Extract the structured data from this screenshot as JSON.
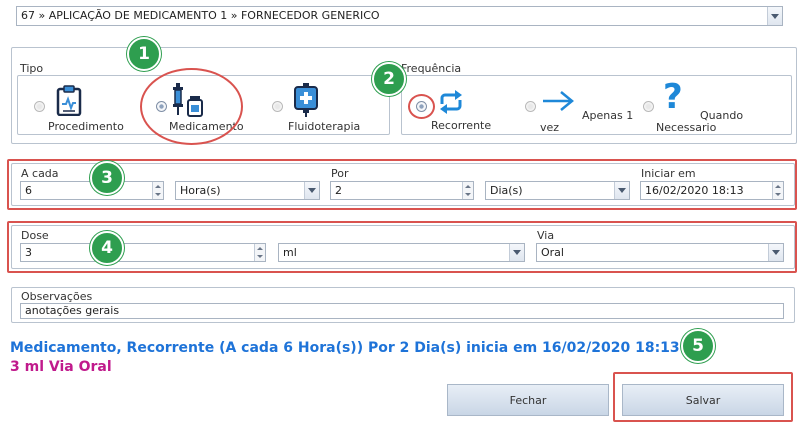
{
  "product_select": {
    "value": "67 » APLICAÇÃO DE MEDICAMENTO 1 » FORNECEDOR GENERICO"
  },
  "tipo": {
    "label": "Tipo",
    "options": [
      {
        "label": "Procedimento",
        "icon": "clipboard-chart-icon",
        "checked": false
      },
      {
        "label": "Medicamento",
        "icon": "syringe-vial-icon",
        "checked": true
      },
      {
        "label": "Fluidoterapia",
        "icon": "iv-bag-icon",
        "checked": false
      }
    ]
  },
  "frequencia": {
    "label": "Frequência",
    "options": [
      {
        "label": "Recorrente",
        "icon": "repeat-icon",
        "checked": true
      },
      {
        "label_a": "Apenas 1",
        "label_b": "vez",
        "icon": "arrow-right-icon",
        "checked": false
      },
      {
        "label_a": "Quando",
        "label_b": "Necessario",
        "icon": "question-icon",
        "checked": false
      }
    ]
  },
  "schedule": {
    "a_cada_label": "A cada",
    "a_cada_value": "6",
    "unit1_value": "Hora(s)",
    "por_label": "Por",
    "por_value": "2",
    "unit2_value": "Dia(s)",
    "iniciar_label": "Iniciar em",
    "iniciar_value": "16/02/2020 18:13"
  },
  "dose": {
    "dose_label": "Dose",
    "dose_value": "3",
    "unit_value": "ml",
    "via_label": "Via",
    "via_value": "Oral"
  },
  "observacoes": {
    "label": "Observações",
    "value": "anotações gerais"
  },
  "summary": {
    "line1": "Medicamento, Recorrente (A cada 6 Hora(s)) Por 2 Dia(s) inicia em 16/02/2020 18:13",
    "line2": "3 ml Via Oral"
  },
  "buttons": {
    "close": "Fechar",
    "save": "Salvar"
  },
  "badges": [
    "1",
    "2",
    "3",
    "4",
    "5"
  ],
  "colors": {
    "badge": "#2e9e4f",
    "highlight": "#d9534f",
    "summary1": "#1e73d8",
    "summary2": "#c01a8c"
  }
}
